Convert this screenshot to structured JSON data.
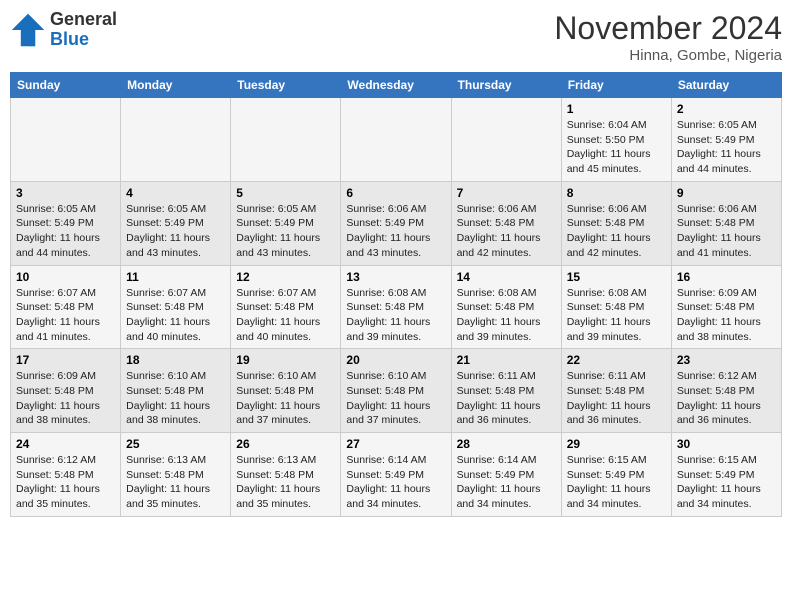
{
  "logo": {
    "general": "General",
    "blue": "Blue"
  },
  "header": {
    "month": "November 2024",
    "location": "Hinna, Gombe, Nigeria"
  },
  "weekdays": [
    "Sunday",
    "Monday",
    "Tuesday",
    "Wednesday",
    "Thursday",
    "Friday",
    "Saturday"
  ],
  "weeks": [
    [
      {
        "day": "",
        "info": ""
      },
      {
        "day": "",
        "info": ""
      },
      {
        "day": "",
        "info": ""
      },
      {
        "day": "",
        "info": ""
      },
      {
        "day": "",
        "info": ""
      },
      {
        "day": "1",
        "info": "Sunrise: 6:04 AM\nSunset: 5:50 PM\nDaylight: 11 hours and 45 minutes."
      },
      {
        "day": "2",
        "info": "Sunrise: 6:05 AM\nSunset: 5:49 PM\nDaylight: 11 hours and 44 minutes."
      }
    ],
    [
      {
        "day": "3",
        "info": "Sunrise: 6:05 AM\nSunset: 5:49 PM\nDaylight: 11 hours and 44 minutes."
      },
      {
        "day": "4",
        "info": "Sunrise: 6:05 AM\nSunset: 5:49 PM\nDaylight: 11 hours and 43 minutes."
      },
      {
        "day": "5",
        "info": "Sunrise: 6:05 AM\nSunset: 5:49 PM\nDaylight: 11 hours and 43 minutes."
      },
      {
        "day": "6",
        "info": "Sunrise: 6:06 AM\nSunset: 5:49 PM\nDaylight: 11 hours and 43 minutes."
      },
      {
        "day": "7",
        "info": "Sunrise: 6:06 AM\nSunset: 5:48 PM\nDaylight: 11 hours and 42 minutes."
      },
      {
        "day": "8",
        "info": "Sunrise: 6:06 AM\nSunset: 5:48 PM\nDaylight: 11 hours and 42 minutes."
      },
      {
        "day": "9",
        "info": "Sunrise: 6:06 AM\nSunset: 5:48 PM\nDaylight: 11 hours and 41 minutes."
      }
    ],
    [
      {
        "day": "10",
        "info": "Sunrise: 6:07 AM\nSunset: 5:48 PM\nDaylight: 11 hours and 41 minutes."
      },
      {
        "day": "11",
        "info": "Sunrise: 6:07 AM\nSunset: 5:48 PM\nDaylight: 11 hours and 40 minutes."
      },
      {
        "day": "12",
        "info": "Sunrise: 6:07 AM\nSunset: 5:48 PM\nDaylight: 11 hours and 40 minutes."
      },
      {
        "day": "13",
        "info": "Sunrise: 6:08 AM\nSunset: 5:48 PM\nDaylight: 11 hours and 39 minutes."
      },
      {
        "day": "14",
        "info": "Sunrise: 6:08 AM\nSunset: 5:48 PM\nDaylight: 11 hours and 39 minutes."
      },
      {
        "day": "15",
        "info": "Sunrise: 6:08 AM\nSunset: 5:48 PM\nDaylight: 11 hours and 39 minutes."
      },
      {
        "day": "16",
        "info": "Sunrise: 6:09 AM\nSunset: 5:48 PM\nDaylight: 11 hours and 38 minutes."
      }
    ],
    [
      {
        "day": "17",
        "info": "Sunrise: 6:09 AM\nSunset: 5:48 PM\nDaylight: 11 hours and 38 minutes."
      },
      {
        "day": "18",
        "info": "Sunrise: 6:10 AM\nSunset: 5:48 PM\nDaylight: 11 hours and 38 minutes."
      },
      {
        "day": "19",
        "info": "Sunrise: 6:10 AM\nSunset: 5:48 PM\nDaylight: 11 hours and 37 minutes."
      },
      {
        "day": "20",
        "info": "Sunrise: 6:10 AM\nSunset: 5:48 PM\nDaylight: 11 hours and 37 minutes."
      },
      {
        "day": "21",
        "info": "Sunrise: 6:11 AM\nSunset: 5:48 PM\nDaylight: 11 hours and 36 minutes."
      },
      {
        "day": "22",
        "info": "Sunrise: 6:11 AM\nSunset: 5:48 PM\nDaylight: 11 hours and 36 minutes."
      },
      {
        "day": "23",
        "info": "Sunrise: 6:12 AM\nSunset: 5:48 PM\nDaylight: 11 hours and 36 minutes."
      }
    ],
    [
      {
        "day": "24",
        "info": "Sunrise: 6:12 AM\nSunset: 5:48 PM\nDaylight: 11 hours and 35 minutes."
      },
      {
        "day": "25",
        "info": "Sunrise: 6:13 AM\nSunset: 5:48 PM\nDaylight: 11 hours and 35 minutes."
      },
      {
        "day": "26",
        "info": "Sunrise: 6:13 AM\nSunset: 5:48 PM\nDaylight: 11 hours and 35 minutes."
      },
      {
        "day": "27",
        "info": "Sunrise: 6:14 AM\nSunset: 5:49 PM\nDaylight: 11 hours and 34 minutes."
      },
      {
        "day": "28",
        "info": "Sunrise: 6:14 AM\nSunset: 5:49 PM\nDaylight: 11 hours and 34 minutes."
      },
      {
        "day": "29",
        "info": "Sunrise: 6:15 AM\nSunset: 5:49 PM\nDaylight: 11 hours and 34 minutes."
      },
      {
        "day": "30",
        "info": "Sunrise: 6:15 AM\nSunset: 5:49 PM\nDaylight: 11 hours and 34 minutes."
      }
    ]
  ]
}
